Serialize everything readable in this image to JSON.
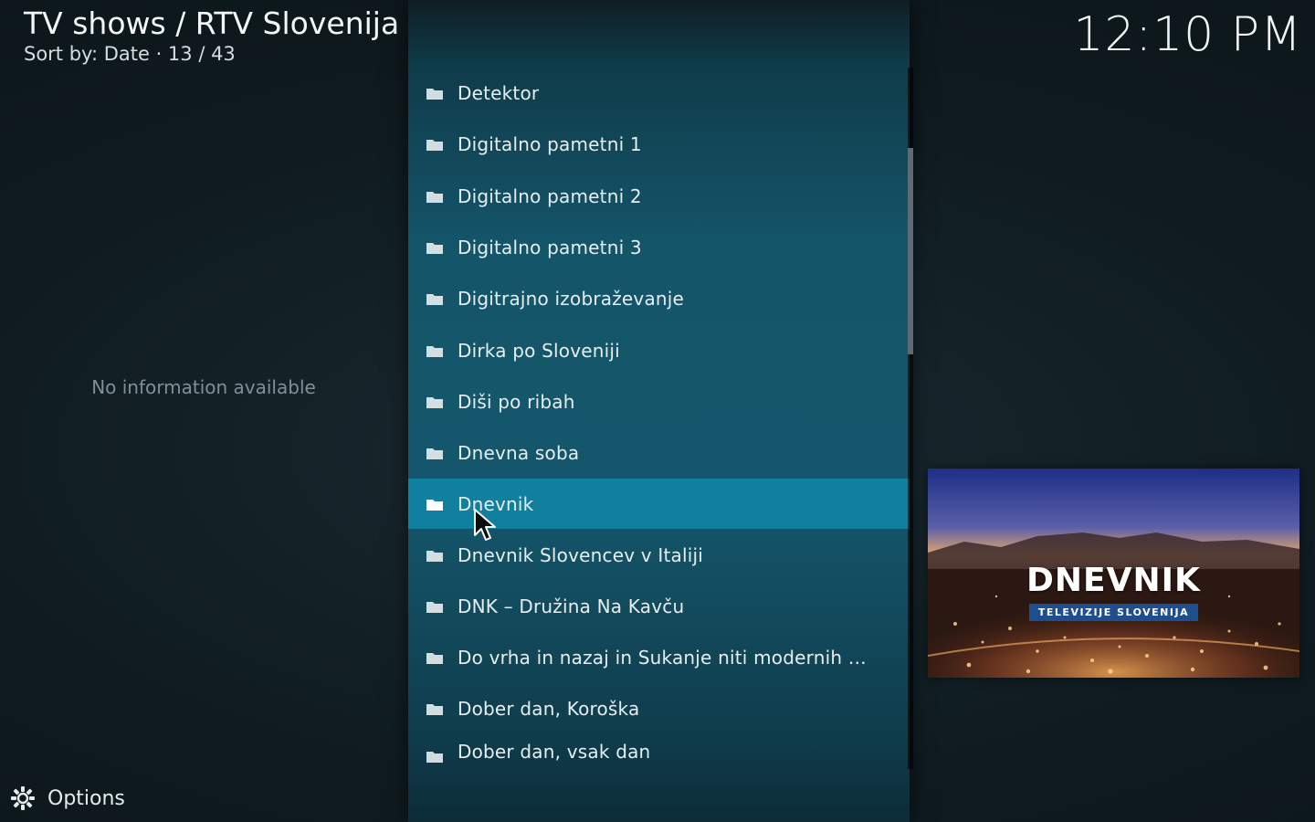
{
  "header": {
    "title": "TV shows / RTV Slovenija",
    "subtitle": "Sort by: Date  ·  13 / 43"
  },
  "clock": "12:10 PM",
  "info": {
    "text": "No information available"
  },
  "options": {
    "label": "Options",
    "icon": "gear-icon"
  },
  "list": {
    "items": [
      {
        "label": "Detektor"
      },
      {
        "label": "Digitalno pametni 1"
      },
      {
        "label": "Digitalno pametni 2"
      },
      {
        "label": "Digitalno pametni 3"
      },
      {
        "label": "Digitrajno izobraževanje"
      },
      {
        "label": "Dirka po Sloveniji"
      },
      {
        "label": "Diši po ribah"
      },
      {
        "label": "Dnevna soba"
      },
      {
        "label": "Dnevnik"
      },
      {
        "label": "Dnevnik Slovencev v Italiji"
      },
      {
        "label": "DNK – Družina Na Kavču"
      },
      {
        "label": "Do vrha in nazaj in Sukanje niti modernih um..."
      },
      {
        "label": "Dober dan, Koroška"
      },
      {
        "label": "Dober dan, vsak dan"
      }
    ],
    "selected_index": 8,
    "item_icon": "folder-icon"
  },
  "thumbnail": {
    "title": "DNEVNIK",
    "subtitle": "TELEVIZIJE SLOVENIJA"
  },
  "colors": {
    "accent": "#11809f",
    "panel": "#14566b"
  }
}
